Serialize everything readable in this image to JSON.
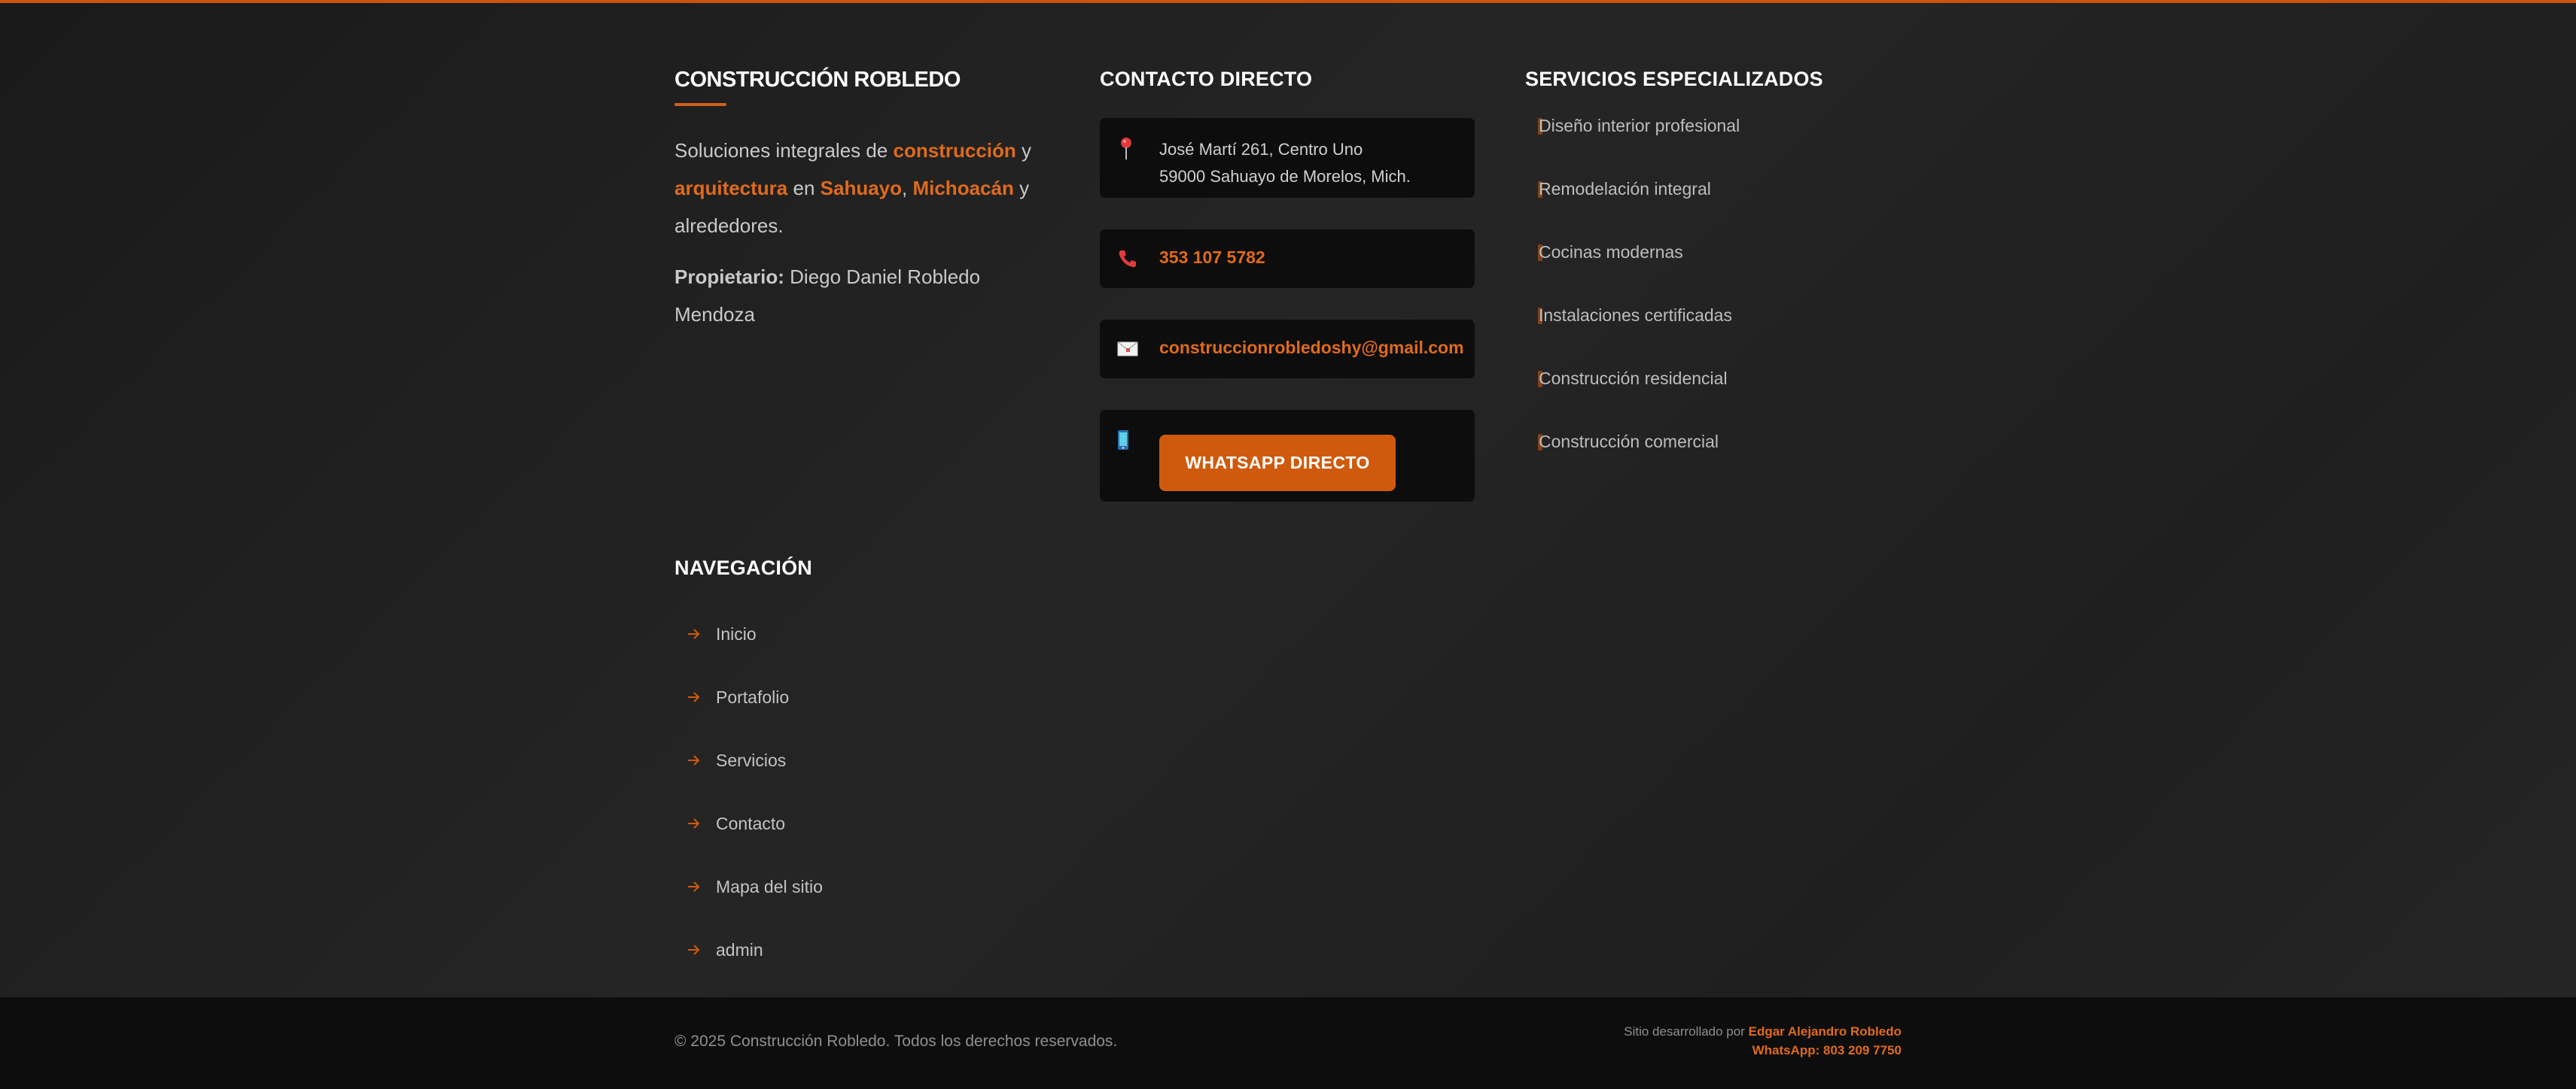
{
  "colors": {
    "accent": "#cf5a0d",
    "accent_text": "#e06a1c",
    "background": "#1f1f1f",
    "card": "#0d0d0d",
    "bottom_bar": "#0d0d0d"
  },
  "brand": {
    "title": "CONSTRUCCIÓN ROBLEDO",
    "desc_1": "Soluciones integrales de ",
    "desc_hl_1": "construcción",
    "desc_2": " y ",
    "desc_hl_2": "arquitectura",
    "desc_3": " en ",
    "desc_hl_3": "Sahuayo",
    "desc_4": ", ",
    "desc_hl_4": "Michoacán",
    "desc_5": " y alrededores.",
    "owner_label": "Propietario:",
    "owner_name": " Diego Daniel Robledo Mendoza"
  },
  "contact": {
    "heading": "CONTACTO DIRECTO",
    "address_line1": "José Martí 261, Centro Uno",
    "address_line2": "59000 Sahuayo de Morelos, Mich.",
    "address_icon": "map-pin-icon",
    "phone": "353 107 5782",
    "phone_icon": "phone-icon",
    "email": "construccionrobledoshy@gmail.com",
    "email_icon": "envelope-icon",
    "whatsapp_label": "WHATSAPP DIRECTO",
    "whatsapp_icon": "mobile-phone-icon"
  },
  "services": {
    "heading": "SERVICIOS ESPECIALIZADOS",
    "items": [
      {
        "label": "Diseño interior profesional"
      },
      {
        "label": "Remodelación integral"
      },
      {
        "label": "Cocinas modernas"
      },
      {
        "label": "Instalaciones certificadas"
      },
      {
        "label": "Construcción residencial"
      },
      {
        "label": "Construcción comercial"
      }
    ]
  },
  "navigation": {
    "heading": "NAVEGACIÓN",
    "arrow_icon": "arrow-right-icon",
    "items": [
      {
        "label": "Inicio"
      },
      {
        "label": "Portafolio"
      },
      {
        "label": "Servicios"
      },
      {
        "label": "Contacto"
      },
      {
        "label": "Mapa del sitio"
      },
      {
        "label": "admin"
      }
    ]
  },
  "bottom": {
    "copyright": "© 2025 Construcción Robledo. Todos los derechos reservados.",
    "credits_prefix": "Sitio desarrollado por ",
    "credits_name": "Edgar Alejandro Robledo",
    "credits_whatsapp": "WhatsApp: 803 209 7750"
  }
}
